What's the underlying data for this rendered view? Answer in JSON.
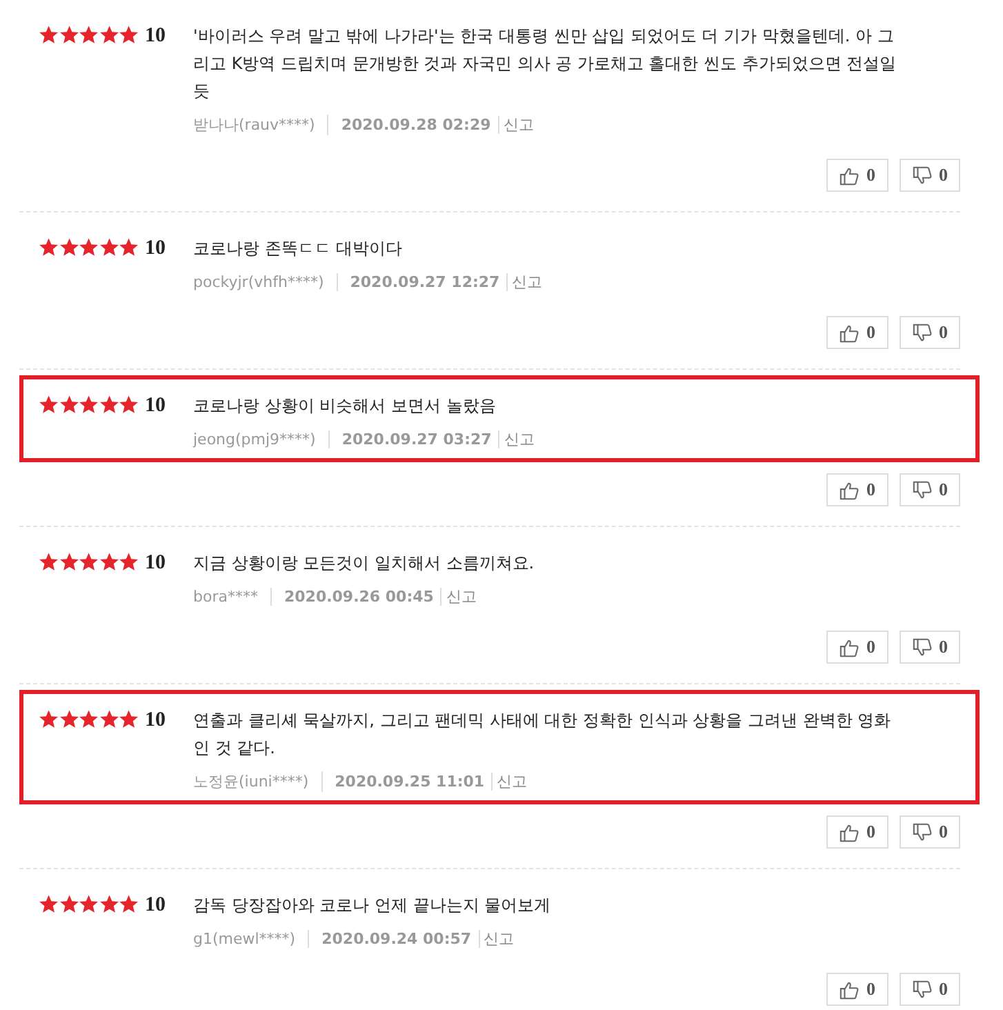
{
  "reviews": [
    {
      "stars": 5,
      "score": "10",
      "text": "'바이러스 우려 말고 밖에 나가라'는 한국 대통령 씬만 삽입 되었어도 더 기가 막혔을텐데. 아 그리고 K방역 드립치며 문개방한 것과 자국민 의사 공 가로채고 홀대한 씬도 추가되었으면 전설일듯",
      "author": "받나나(rauv****)",
      "date": "2020.09.28 02:29",
      "report": "신고",
      "likes": "0",
      "dislikes": "0",
      "highlighted": false
    },
    {
      "stars": 5,
      "score": "10",
      "text": "코로나랑 존똑ㄷㄷ 대박이다",
      "author": "pockyjr(vhfh****)",
      "date": "2020.09.27 12:27",
      "report": "신고",
      "likes": "0",
      "dislikes": "0",
      "highlighted": false
    },
    {
      "stars": 5,
      "score": "10",
      "text": "코로나랑 상황이 비슷해서 보면서 놀랐음",
      "author": "jeong(pmj9****)",
      "date": "2020.09.27 03:27",
      "report": "신고",
      "likes": "0",
      "dislikes": "0",
      "highlighted": true
    },
    {
      "stars": 5,
      "score": "10",
      "text": "지금 상황이랑 모든것이 일치해서 소름끼쳐요.",
      "author": "bora****",
      "date": "2020.09.26 00:45",
      "report": "신고",
      "likes": "0",
      "dislikes": "0",
      "highlighted": false
    },
    {
      "stars": 5,
      "score": "10",
      "text": "연출과 클리셰 묵살까지, 그리고 팬데믹 사태에 대한 정확한 인식과 상황을 그려낸 완벽한 영화인 것 같다.",
      "author": "노정윤(iuni****)",
      "date": "2020.09.25 11:01",
      "report": "신고",
      "likes": "0",
      "dislikes": "0",
      "highlighted": true
    },
    {
      "stars": 5,
      "score": "10",
      "text": "감독 당장잡아와 코로나 언제 끝나는지 물어보게",
      "author": "g1(mewl****)",
      "date": "2020.09.24 00:57",
      "report": "신고",
      "likes": "0",
      "dislikes": "0",
      "highlighted": false
    }
  ]
}
